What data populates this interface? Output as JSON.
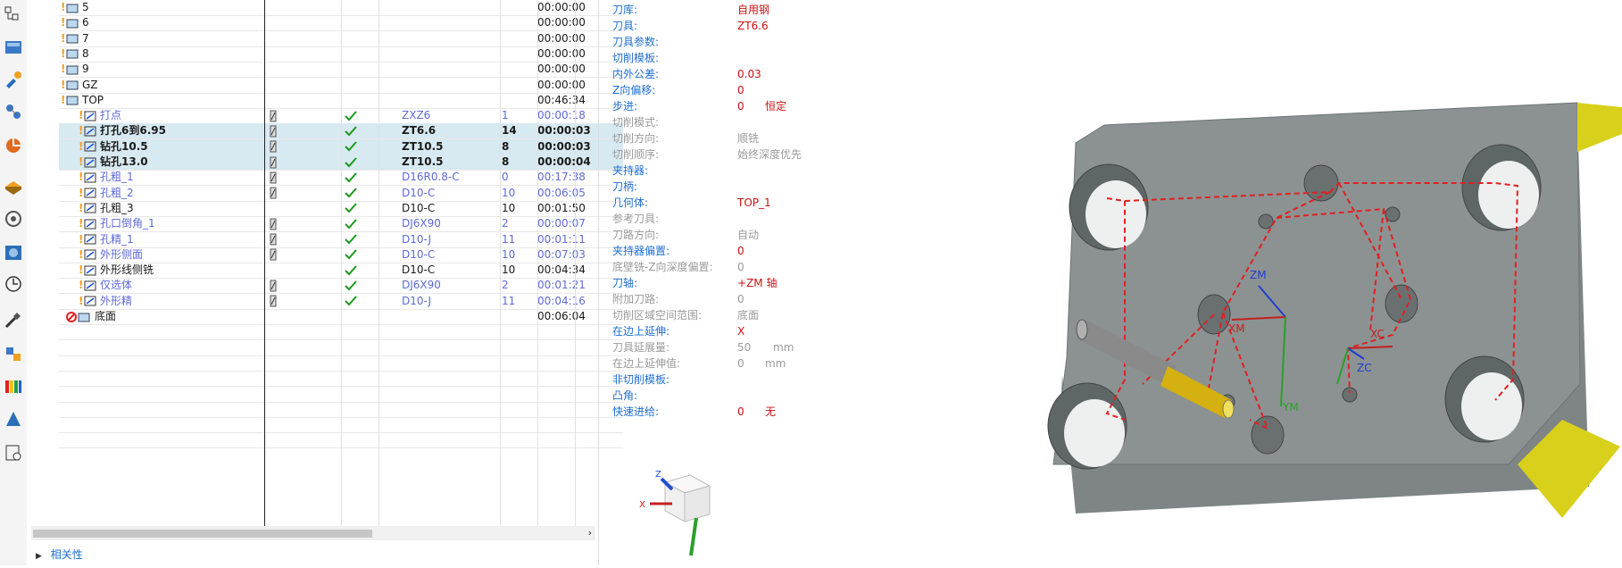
{
  "nav": {
    "rows": [
      {
        "name": "5",
        "time": "00:00:00"
      },
      {
        "name": "6",
        "time": "00:00:00"
      },
      {
        "name": "7",
        "time": "00:00:00"
      },
      {
        "name": "8",
        "time": "00:00:00"
      },
      {
        "name": "9",
        "time": "00:00:00"
      },
      {
        "name": "GZ",
        "time": "00:00:00"
      },
      {
        "name": "TOP",
        "time": "00:46:34"
      },
      {
        "name": "打点",
        "tool": "ZXZ6",
        "num": "1",
        "time": "00:00:18"
      },
      {
        "name": "打孔6到6.95",
        "tool": "ZT6.6",
        "num": "14",
        "time": "00:00:03"
      },
      {
        "name": "钻孔10.5",
        "tool": "ZT10.5",
        "num": "8",
        "time": "00:00:03"
      },
      {
        "name": "钻孔13.0",
        "tool": "ZT10.5",
        "num": "8",
        "time": "00:00:04"
      },
      {
        "name": "孔粗_1",
        "tool": "D16R0.8-C",
        "num": "0",
        "time": "00:17:38"
      },
      {
        "name": "孔粗_2",
        "tool": "D10-C",
        "num": "10",
        "time": "00:06:05"
      },
      {
        "name": "孔粗_3",
        "tool": "D10-C",
        "num": "10",
        "time": "00:01:50"
      },
      {
        "name": "孔口倒角_1",
        "tool": "DJ6X90",
        "num": "2",
        "time": "00:00:07"
      },
      {
        "name": "孔精_1",
        "tool": "D10-J",
        "num": "11",
        "time": "00:01:11"
      },
      {
        "name": "外形侧面",
        "tool": "D10-C",
        "num": "10",
        "time": "00:07:03"
      },
      {
        "name": "外形线侧铣",
        "tool": "D10-C",
        "num": "10",
        "time": "00:04:34"
      },
      {
        "name": "仅选体",
        "tool": "DJ6X90",
        "num": "2",
        "time": "00:01:21"
      },
      {
        "name": "外形精",
        "tool": "D10-J",
        "num": "11",
        "time": "00:04:16"
      },
      {
        "name": "底面",
        "time": "00:06:04"
      }
    ],
    "dependencies_label": "相关性"
  },
  "info": {
    "rows": [
      {
        "label": "刀库:",
        "value": "自用钢"
      },
      {
        "label": "刀具:",
        "value": "ZT6.6"
      },
      {
        "label": "刀具参数:",
        "value": ""
      },
      {
        "label": "切削模板:",
        "value": ""
      },
      {
        "label": "内外公差:",
        "value": "0.03"
      },
      {
        "label": "Z向偏移:",
        "value": "0"
      },
      {
        "label": "步进:",
        "value": "0",
        "extra": "恒定"
      },
      {
        "label": "切削模式:",
        "value": ""
      },
      {
        "label": "切削方向:",
        "value": "顺铣"
      },
      {
        "label": "切削顺序:",
        "value": "始终深度优先"
      },
      {
        "label": "夹持器:",
        "value": ""
      },
      {
        "label": "刀柄:",
        "value": ""
      },
      {
        "label": "几何体:",
        "value": "TOP_1"
      },
      {
        "label": "参考刀具:",
        "value": ""
      },
      {
        "label": "刀路方向:",
        "value": "自动"
      },
      {
        "label": "夹持器偏置:",
        "value": "0"
      },
      {
        "label": "底壁铣-Z向深度偏置:",
        "value": "0"
      },
      {
        "label": "刀轴:",
        "value": "+ZM 轴"
      },
      {
        "label": "附加刀路:",
        "value": "0"
      },
      {
        "label": "切削区域空间范围:",
        "value": "底面"
      },
      {
        "label": "在边上延伸:",
        "value": "X"
      },
      {
        "label": "刀具延展量:",
        "value": "50",
        "extra": "mm"
      },
      {
        "label": "在边上延伸值:",
        "value": "0",
        "extra": "mm"
      },
      {
        "label": "非切削模板:",
        "value": ""
      },
      {
        "label": "凸角:",
        "value": ""
      },
      {
        "label": "快速进给:",
        "value": "0",
        "extra": "无"
      }
    ]
  },
  "viewport": {
    "axis_labels": {
      "zm": "ZM",
      "xm": "XM",
      "ym": "YM",
      "xc": "XC",
      "zc": "ZC",
      "z": "Z",
      "x": "X"
    }
  },
  "colors": {
    "accent": "#1f6ecf",
    "value_red": "#cc1111",
    "selected_row": "#d7e9f1",
    "check_green": "#1a9a1a",
    "part_gray": "#8f9696",
    "path_red": "#e02020",
    "chamfer_yellow": "#d8d01a"
  }
}
